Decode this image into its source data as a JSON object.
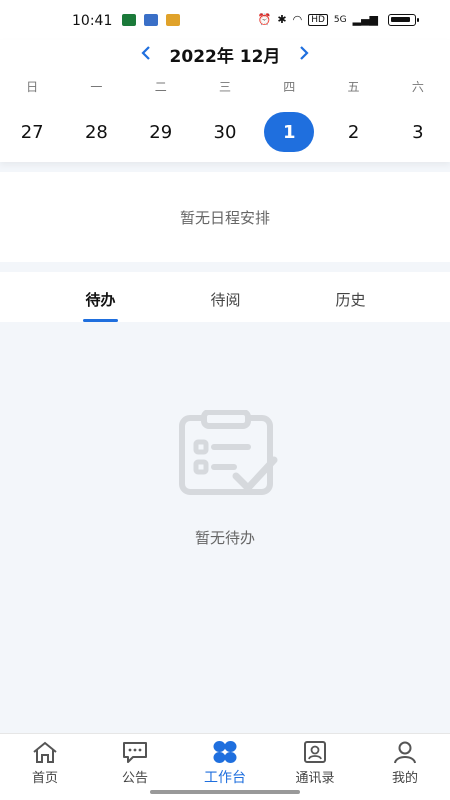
{
  "status_bar": {
    "time": "10:41",
    "network": "5G",
    "hd": "HD"
  },
  "calendar": {
    "prev_icon": "chevron-left-icon",
    "next_icon": "chevron-right-icon",
    "month_label": "2022年 12月",
    "weekdays": [
      "日",
      "一",
      "二",
      "三",
      "四",
      "五",
      "六"
    ],
    "dates": [
      "27",
      "28",
      "29",
      "30",
      "1",
      "2",
      "3"
    ],
    "selected_date": "1",
    "accent_color": "#1f6fde"
  },
  "schedule": {
    "empty_text": "暂无日程安排"
  },
  "tasks": {
    "tabs": [
      {
        "label": "待办",
        "active": true
      },
      {
        "label": "待阅",
        "active": false
      },
      {
        "label": "历史",
        "active": false
      }
    ],
    "empty_text": "暂无待办",
    "empty_icon": "clipboard-check-icon"
  },
  "bottom_nav": [
    {
      "label": "首页",
      "icon": "home-icon",
      "active": false
    },
    {
      "label": "公告",
      "icon": "message-icon",
      "active": false
    },
    {
      "label": "工作台",
      "icon": "workbench-grid-icon",
      "active": true
    },
    {
      "label": "通讯录",
      "icon": "contacts-icon",
      "active": false
    },
    {
      "label": "我的",
      "icon": "user-icon",
      "active": false
    }
  ]
}
